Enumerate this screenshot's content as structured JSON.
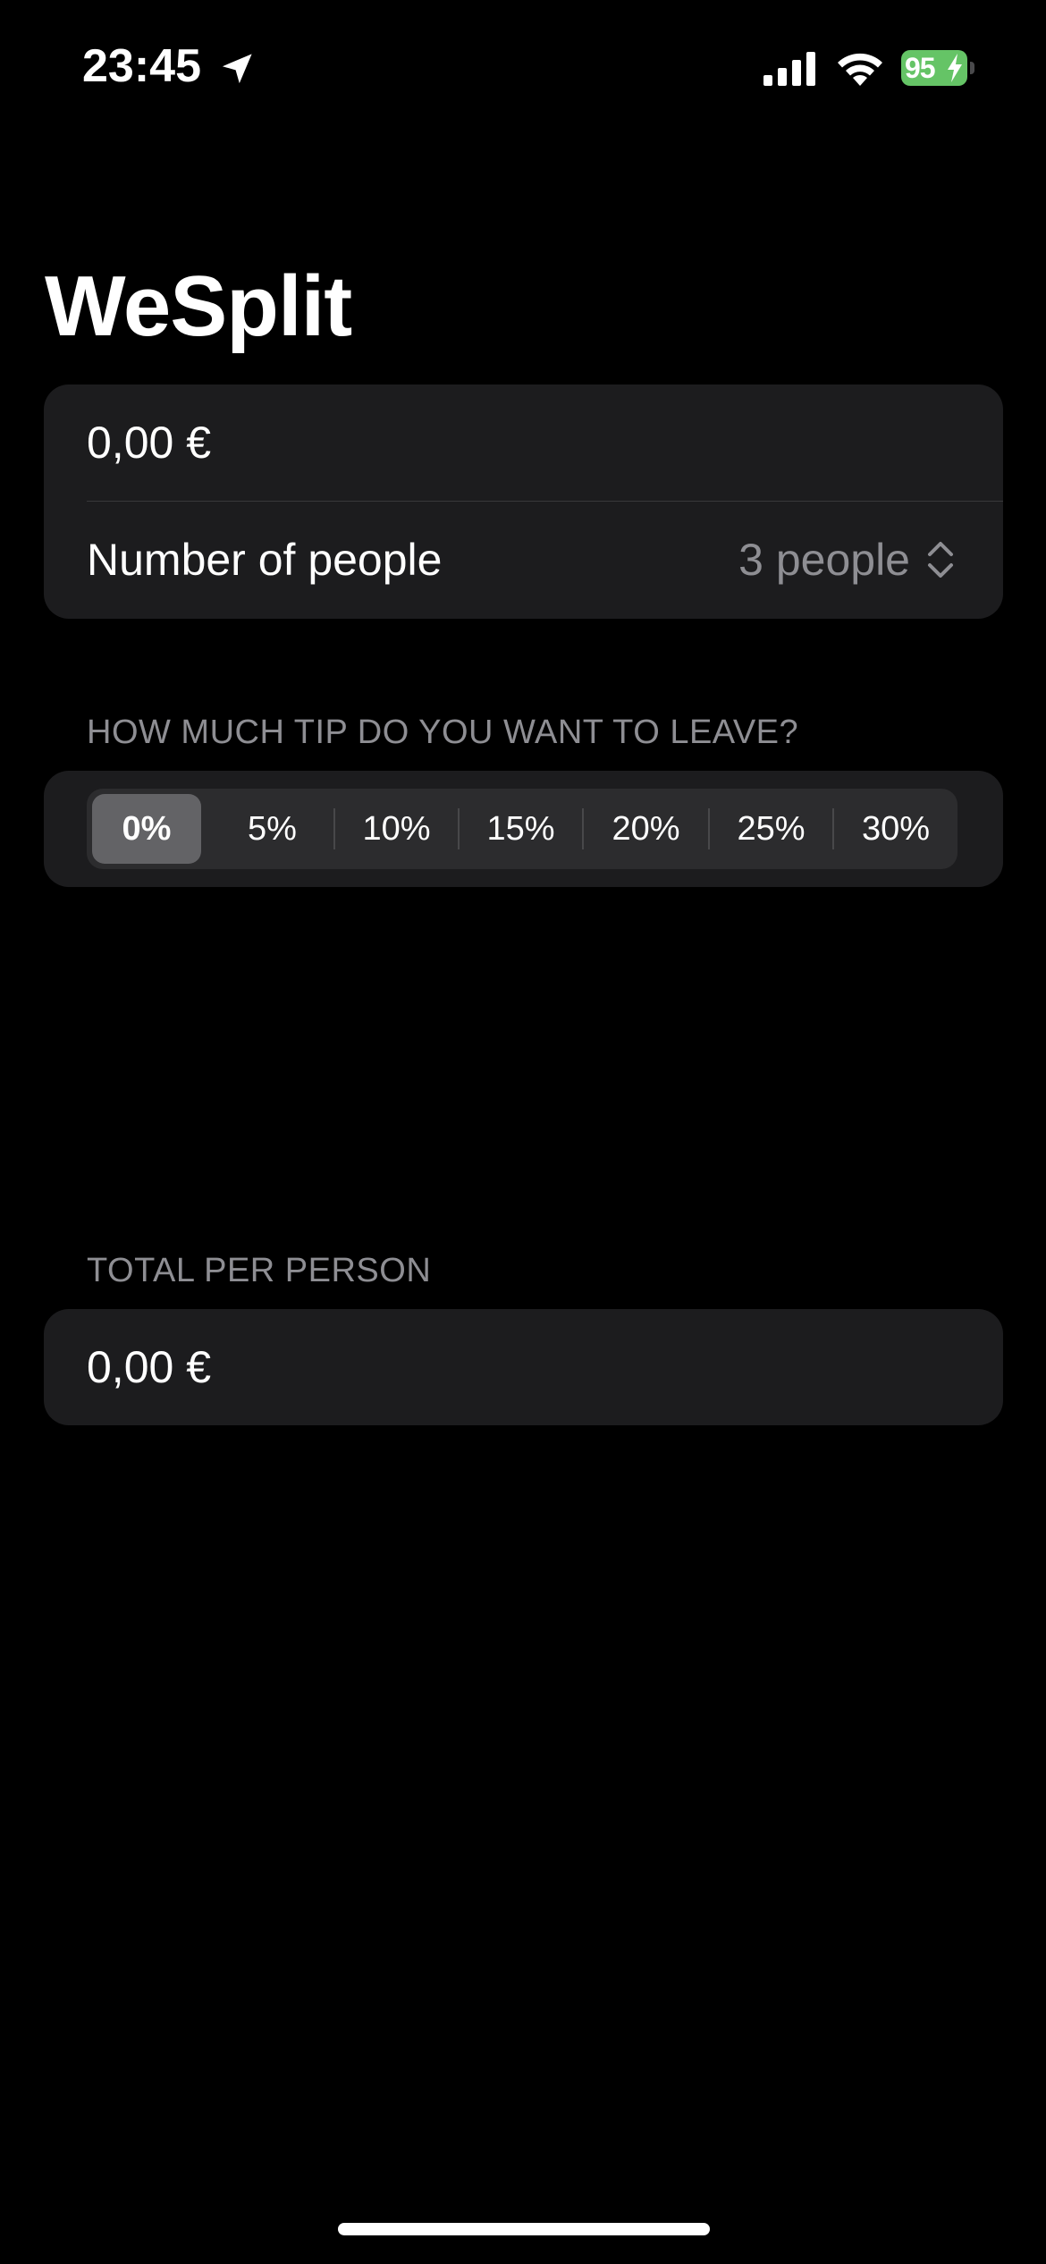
{
  "status_bar": {
    "time": "23:45",
    "battery_level": "95",
    "battery_color": "#65c466",
    "icons": [
      "location-arrow-icon",
      "cellular-signal-icon",
      "wifi-icon",
      "battery-charging-icon"
    ]
  },
  "title": "WeSplit",
  "input_section": {
    "amount_value": "0,00 €",
    "people_label": "Number of people",
    "people_value": "3 people"
  },
  "tip_section": {
    "header": "HOW MUCH TIP DO YOU WANT TO LEAVE?",
    "options": [
      "0%",
      "5%",
      "10%",
      "15%",
      "20%",
      "25%",
      "30%"
    ],
    "selected": "0%"
  },
  "total_section": {
    "header": "TOTAL PER PERSON",
    "value": "0,00 €"
  },
  "colors": {
    "background": "#000000",
    "card": "#1c1c1e",
    "secondary_text": "#8e8e93",
    "segment_selected": "#636366"
  }
}
